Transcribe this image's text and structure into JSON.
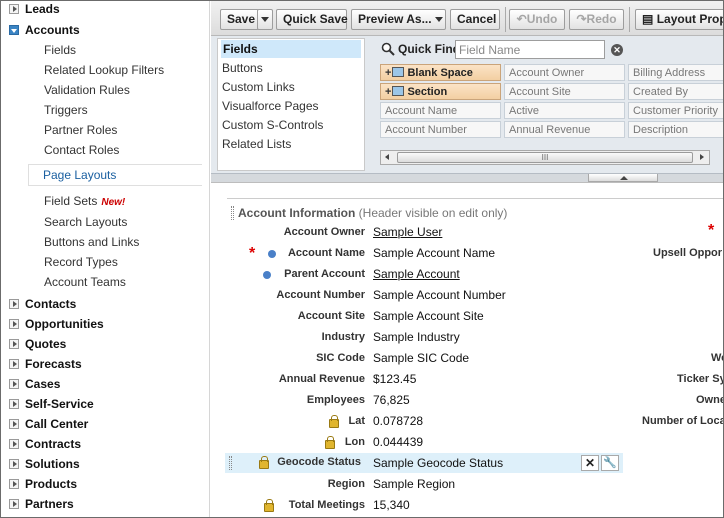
{
  "sidebar": {
    "top_leads": "Leads",
    "top_accounts": "Accounts",
    "sub": {
      "fields": "Fields",
      "related_lookup_filters": "Related Lookup Filters",
      "validation_rules": "Validation Rules",
      "triggers": "Triggers",
      "partner_roles": "Partner Roles",
      "contact_roles": "Contact Roles",
      "page_layouts": "Page Layouts",
      "field_sets": "Field Sets",
      "field_sets_badge": "New!",
      "search_layouts": "Search Layouts",
      "buttons_and_links": "Buttons and Links",
      "record_types": "Record Types",
      "account_teams": "Account Teams"
    },
    "collapsed": [
      "Contacts",
      "Opportunities",
      "Quotes",
      "Forecasts",
      "Cases",
      "Self-Service",
      "Call Center",
      "Contracts",
      "Solutions",
      "Products",
      "Partners"
    ]
  },
  "toolbar": {
    "save": "Save",
    "quick_save": "Quick Save",
    "preview_as": "Preview As...",
    "cancel": "Cancel",
    "undo": "Undo",
    "redo": "Redo",
    "layout_properties": "Layout Properties"
  },
  "palette": {
    "categories": [
      "Fields",
      "Buttons",
      "Custom Links",
      "Visualforce Pages",
      "Custom S-Controls",
      "Related Lists"
    ],
    "quick_find_label": "Quick Find",
    "quick_find_placeholder": "Field Name",
    "grid": [
      [
        "Blank Space",
        "Account Owner",
        "Billing Address"
      ],
      [
        "Section",
        "Account Site",
        "Created By"
      ],
      [
        "Account Name",
        "Active",
        "Customer Priority"
      ],
      [
        "Account Number",
        "Annual Revenue",
        "Description"
      ]
    ],
    "scroll_grip": "III"
  },
  "layout": {
    "section_title": "Account Information",
    "section_note": "(Header visible on edit only)",
    "fields": [
      {
        "label": "Account Owner",
        "value": "Sample User"
      },
      {
        "label": "Account Name",
        "value": "Sample Account Name"
      },
      {
        "label": "Parent Account",
        "value": "Sample Account"
      },
      {
        "label": "Account Number",
        "value": "Sample Account Number"
      },
      {
        "label": "Account Site",
        "value": "Sample Account Site"
      },
      {
        "label": "Industry",
        "value": "Sample Industry"
      },
      {
        "label": "SIC Code",
        "value": "Sample SIC Code"
      },
      {
        "label": "Annual Revenue",
        "value": "$123.45"
      },
      {
        "label": "Employees",
        "value": "76,825"
      },
      {
        "label": "Lat",
        "value": "0.078728"
      },
      {
        "label": "Lon",
        "value": "0.044439"
      },
      {
        "label": "Geocode Status",
        "value": "Sample Geocode Status"
      },
      {
        "label": "Region",
        "value": "Sample Region"
      },
      {
        "label": "Total Meetings",
        "value": "15,340"
      }
    ],
    "right_labels": [
      "Upsell Oppor",
      "We",
      "Ticker Sy",
      "Owne",
      "Number of Loca"
    ]
  }
}
